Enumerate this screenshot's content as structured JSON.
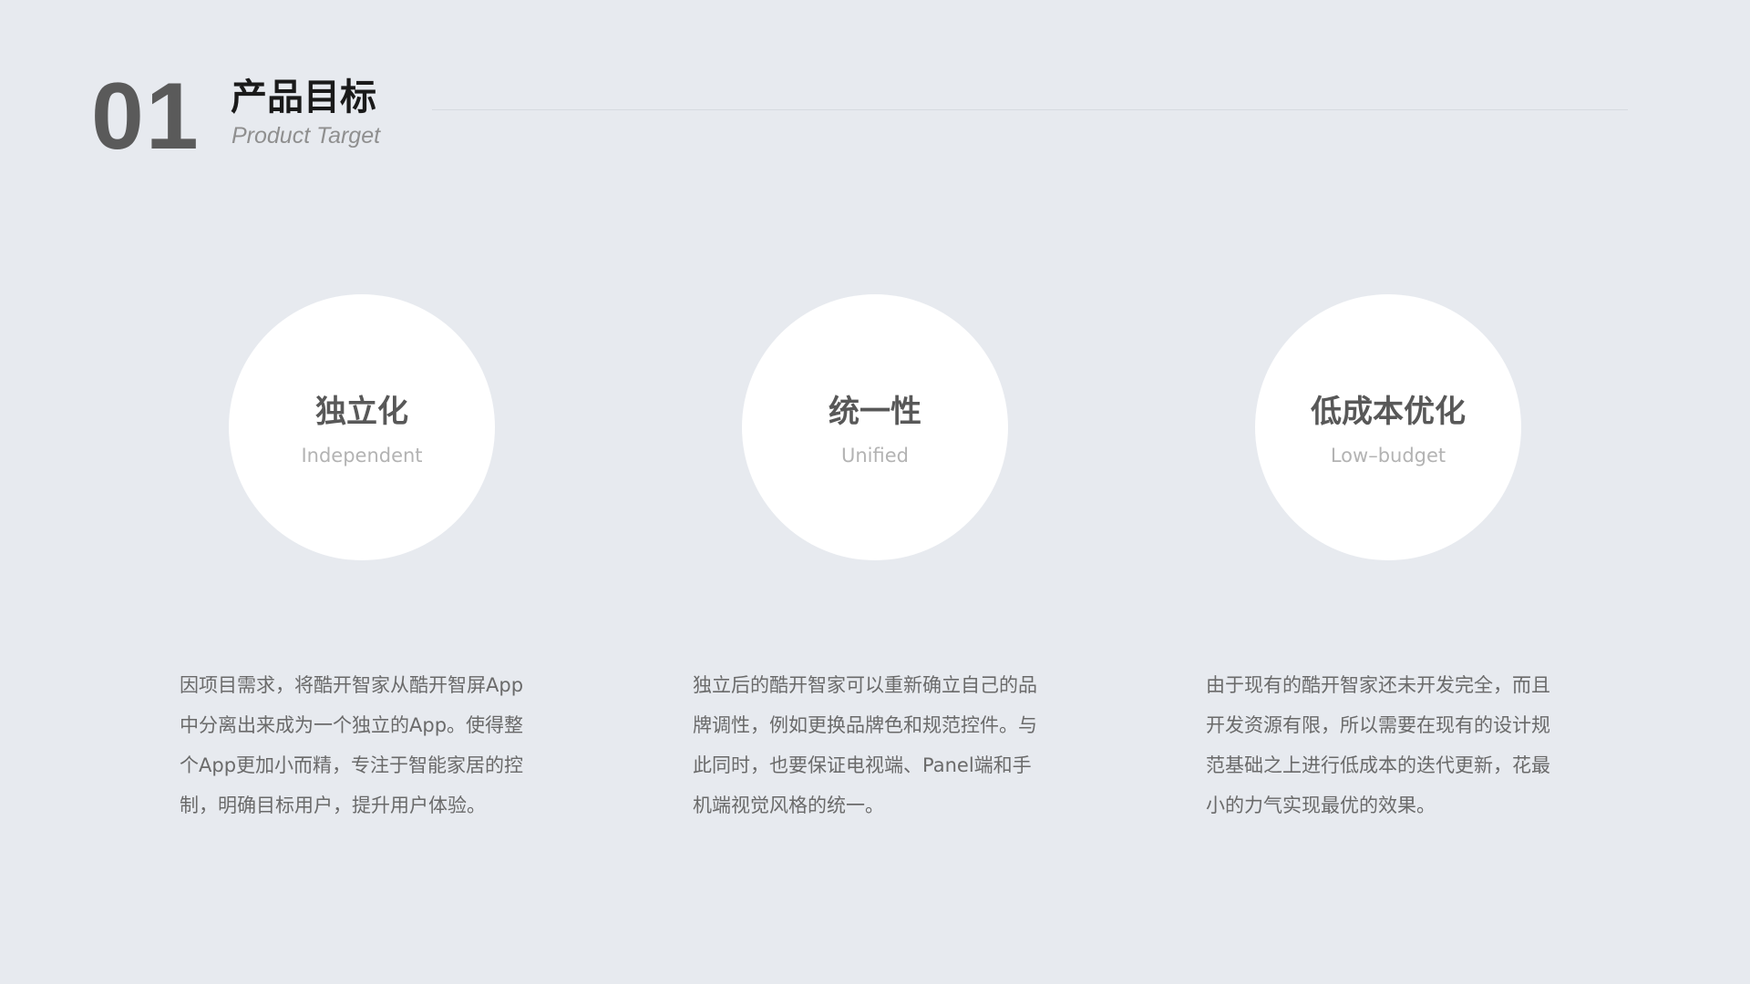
{
  "header": {
    "number": "01",
    "title": "产品目标",
    "subtitle": "Product Target"
  },
  "pillars": [
    {
      "title": "独立化",
      "subtitle": "Independent",
      "description_lines": [
        "因项目需求，将酷开智家从酷开智屏App",
        "中分离出来成为一个独立的App。使得整",
        "个App更加小而精，专注于智能家居的控",
        "制，明确目标用户，提升用户体验。"
      ]
    },
    {
      "title": "统一性",
      "subtitle": "Unified",
      "description_lines": [
        "独立后的酷开智家可以重新确立自己的品",
        "牌调性，例如更换品牌色和规范控件。与",
        "此同时，也要保证电视端、Panel端和手",
        "机端视觉风格的统一。"
      ]
    },
    {
      "title": "低成本优化",
      "subtitle": "Low–budget",
      "description_lines": [
        "由于现有的酷开智家还未开发完全，而且",
        "开发资源有限，所以需要在现有的设计规",
        "范基础之上进行低成本的迭代更新，花最",
        "小的力气实现最优的效果。"
      ]
    }
  ]
}
